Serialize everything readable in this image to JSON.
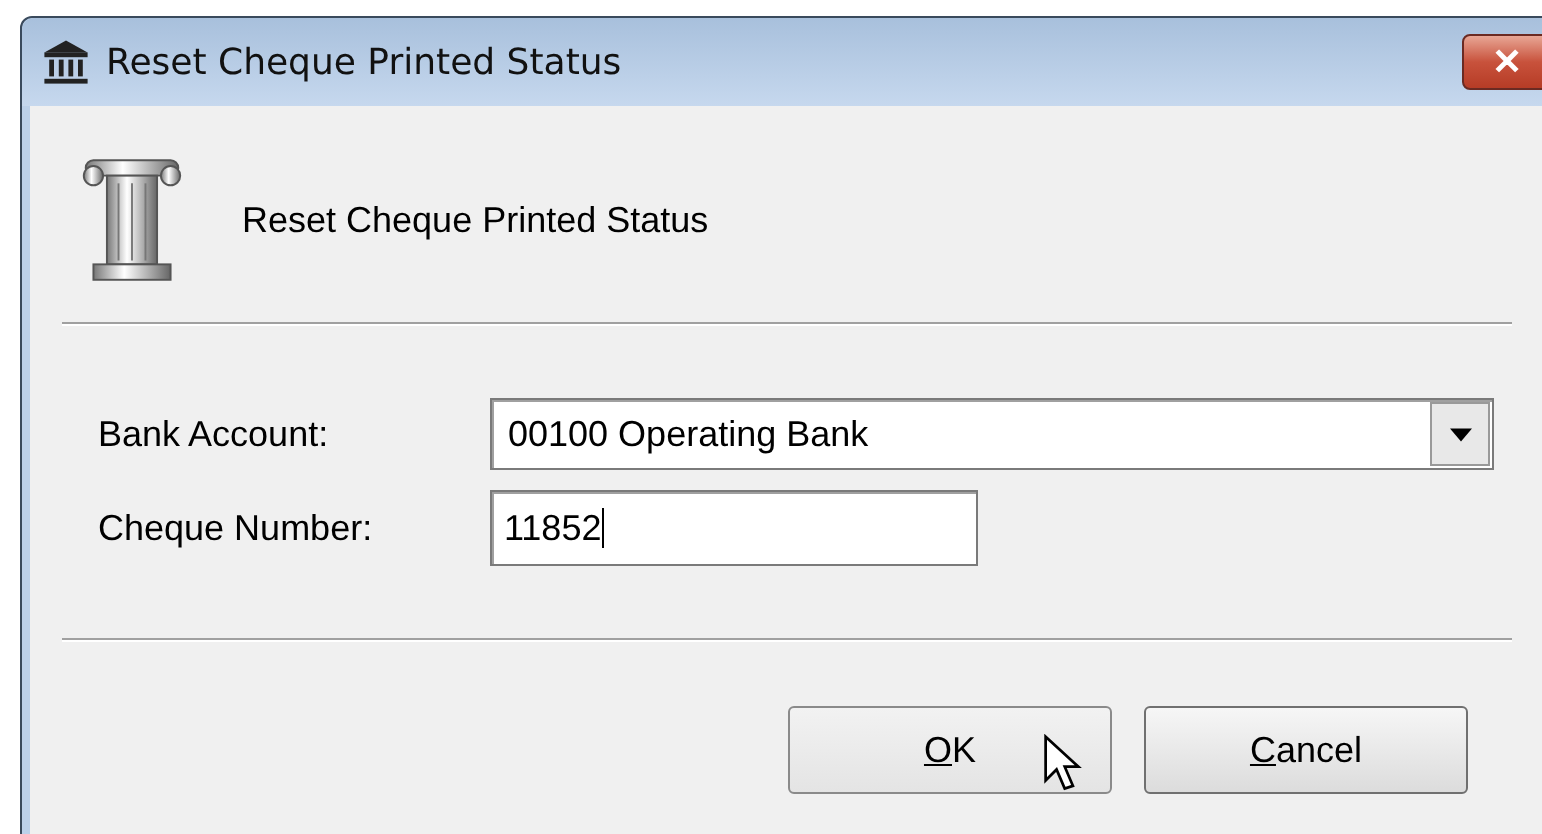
{
  "window": {
    "title": "Reset Cheque Printed Status",
    "close_glyph": "✕"
  },
  "header": {
    "text": "Reset Cheque Printed Status"
  },
  "fields": [
    {
      "kind": "dropdown",
      "label": "Bank Account:",
      "value": "00100 Operating Bank",
      "focused": false
    },
    {
      "kind": "text",
      "label": "Cheque Number:",
      "value": "11852",
      "focused": true
    }
  ],
  "buttons": [
    {
      "label": "OK",
      "hovered": true
    },
    {
      "label": "Cancel",
      "hovered": false
    }
  ]
}
